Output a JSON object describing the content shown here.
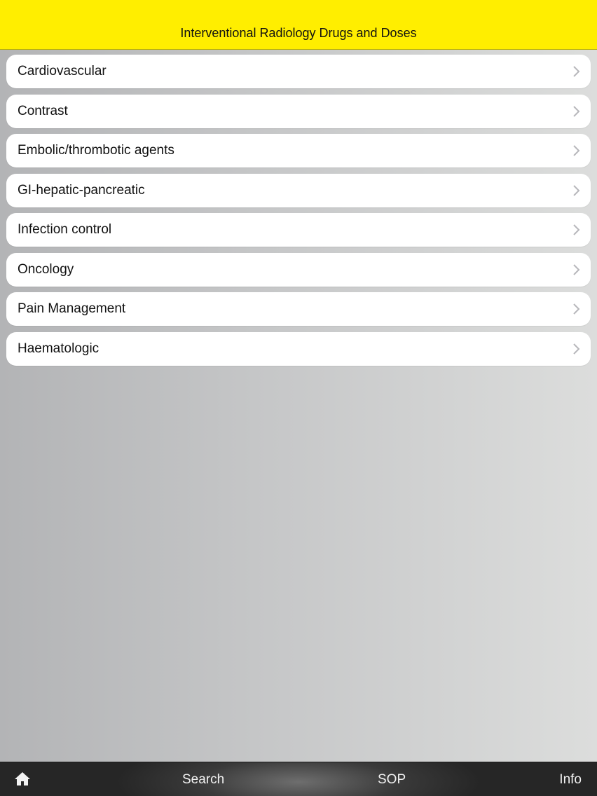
{
  "header": {
    "title": "Interventional Radiology Drugs and Doses",
    "background_color": "#ffee00"
  },
  "categories": [
    {
      "label": "Cardiovascular"
    },
    {
      "label": "Contrast"
    },
    {
      "label": "Embolic/thrombotic agents"
    },
    {
      "label": "GI-hepatic-pancreatic"
    },
    {
      "label": "Infection control"
    },
    {
      "label": "Oncology"
    },
    {
      "label": "Pain Management"
    },
    {
      "label": "Haematologic"
    }
  ],
  "tabbar": {
    "home_icon": "home-icon",
    "search_label": "Search",
    "sop_label": "SOP",
    "info_label": "Info"
  }
}
